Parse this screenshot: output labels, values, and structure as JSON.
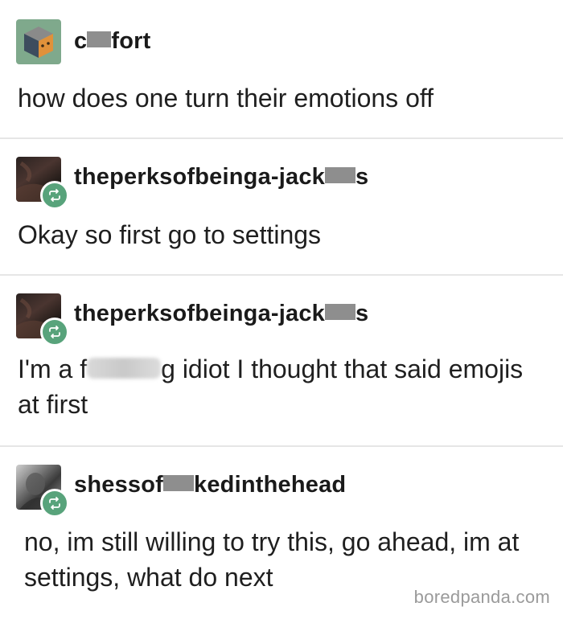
{
  "posts": [
    {
      "username_before": "c",
      "username_after": "fort",
      "body": "how does one turn their emotions off",
      "avatar": "cube-face-icon"
    },
    {
      "username_before": "theperksofbeinga-jack",
      "username_after": "s",
      "body": "Okay so first go to settings",
      "avatar": "dark-photo-avatar"
    },
    {
      "username_before": "theperksofbeinga-jack",
      "username_after": "s",
      "body_before": "I'm a f",
      "body_after": "g idiot I thought that said emojis at first",
      "avatar": "dark-photo-avatar"
    },
    {
      "username_before": "shessof",
      "username_after": "kedinthehead",
      "body": "no, im still willing to try this, go ahead, im at settings, what do next",
      "avatar": "grayscale-photo-avatar"
    }
  ],
  "watermark": "boredpanda.com",
  "colors": {
    "reblog_badge": "#58a37b",
    "cube_avatar_bg": "#7fa98c",
    "redaction": "#8e8e8e"
  }
}
